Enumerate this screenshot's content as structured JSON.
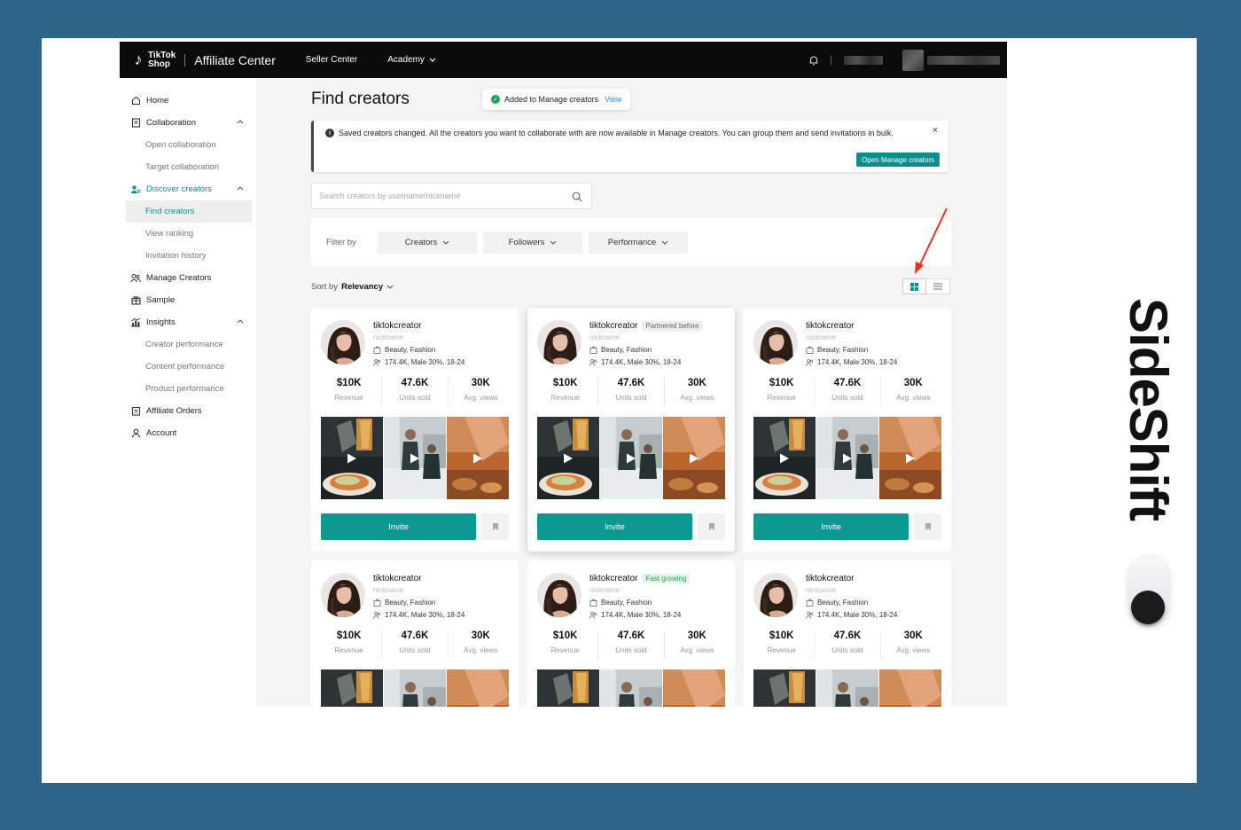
{
  "header": {
    "logo_line1": "TikTok",
    "logo_line2": "Shop",
    "app_name": "Affiliate Center",
    "nav": [
      "Seller Center",
      "Academy"
    ]
  },
  "sidebar": {
    "items": [
      {
        "label": "Home",
        "icon": "home-icon"
      },
      {
        "label": "Collaboration",
        "icon": "document-icon"
      },
      {
        "label": "Open collaboration"
      },
      {
        "label": "Target collaboration"
      },
      {
        "label": "Discover creators",
        "icon": "users-icon"
      },
      {
        "label": "Find creators"
      },
      {
        "label": "View ranking"
      },
      {
        "label": "Invitation history"
      },
      {
        "label": "Manage Creators",
        "icon": "people-icon"
      },
      {
        "label": "Sample",
        "icon": "gift-icon"
      },
      {
        "label": "Insights",
        "icon": "chart-icon"
      },
      {
        "label": "Creator performance"
      },
      {
        "label": "Content performance"
      },
      {
        "label": "Product performance"
      },
      {
        "label": "Affiliate Orders",
        "icon": "clipboard-icon"
      },
      {
        "label": "Account",
        "icon": "person-icon"
      }
    ]
  },
  "main": {
    "title": "Find creators",
    "toast": {
      "text": "Added to Manage creators",
      "link": "View"
    },
    "banner": {
      "text": "Saved creators changed. All the creators you want to collaborate with are now available in Manage creators. You can group them and send invitations in bulk.",
      "button": "Open Manage creators"
    },
    "search": {
      "placeholder": "Search creators by username/nickname",
      "value": ""
    },
    "filter": {
      "label": "Filter by",
      "buttons": [
        "Creators",
        "Followers",
        "Performance"
      ]
    },
    "sort": {
      "label": "Sort by",
      "value": "Relevancy"
    }
  },
  "cards": [
    {
      "name": "tiktokcreator",
      "tag": "",
      "nickname": "nickname",
      "category": "Beauty, Fashion",
      "audience": "174.4K, Male 30%, 18-24",
      "revenue": "$10K",
      "revenue_label": "Revenue",
      "units": "47.6K",
      "units_label": "Units sold",
      "views": "30K",
      "views_label": "Avg. views",
      "invite": "Invite"
    },
    {
      "name": "tiktokcreator",
      "tag": "Partnered before",
      "nickname": "nickname",
      "category": "Beauty, Fashion",
      "audience": "174.4K, Male 30%, 18-24",
      "revenue": "$10K",
      "revenue_label": "Revenue",
      "units": "47.6K",
      "units_label": "Units sold",
      "views": "30K",
      "views_label": "Avg. views",
      "invite": "Invite"
    },
    {
      "name": "tiktokcreator",
      "tag": "",
      "nickname": "nickname",
      "category": "Beauty, Fashion",
      "audience": "174.4K, Male 30%, 18-24",
      "revenue": "$10K",
      "revenue_label": "Revenue",
      "units": "47.6K",
      "units_label": "Units sold",
      "views": "30K",
      "views_label": "Avg. views",
      "invite": "Invite"
    },
    {
      "name": "tiktokcreator",
      "tag": "",
      "nickname": "nickname",
      "category": "Beauty, Fashion",
      "audience": "174.4K, Male 30%, 18-24",
      "revenue": "$10K",
      "revenue_label": "Revenue",
      "units": "47.6K",
      "units_label": "Units sold",
      "views": "30K",
      "views_label": "Avg. views",
      "invite": "Invite"
    },
    {
      "name": "tiktokcreator",
      "tag": "Fast growing",
      "nickname": "nickname",
      "category": "Beauty, Fashion",
      "audience": "174.4K, Male 30%, 18-24",
      "revenue": "$10K",
      "revenue_label": "Revenue",
      "units": "47.6K",
      "units_label": "Units sold",
      "views": "30K",
      "views_label": "Avg. views",
      "invite": "Invite"
    },
    {
      "name": "tiktokcreator",
      "tag": "",
      "nickname": "nickname",
      "category": "Beauty, Fashion",
      "audience": "174.4K, Male 30%, 18-24",
      "revenue": "$10K",
      "revenue_label": "Revenue",
      "units": "47.6K",
      "units_label": "Units sold",
      "views": "30K",
      "views_label": "Avg. views",
      "invite": "Invite"
    }
  ],
  "watermark": {
    "text": "SideShift"
  },
  "colors": {
    "accent": "#0d9891",
    "background": "#2d6487",
    "arrow": "#e8321f"
  }
}
